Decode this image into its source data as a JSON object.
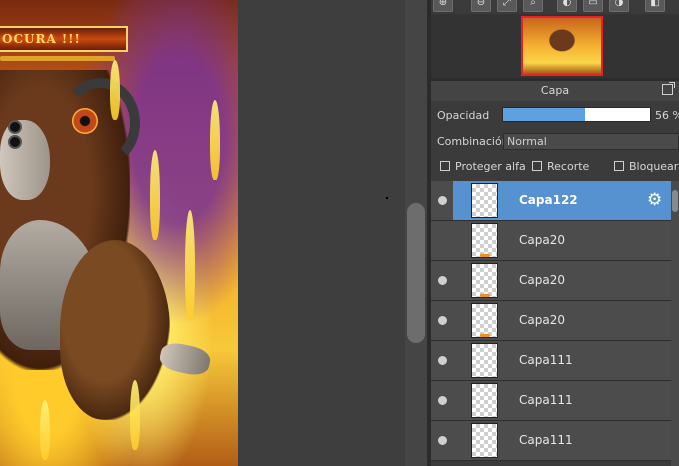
{
  "artwork": {
    "banner_text": "OCURA !!!"
  },
  "nav_toolbar": {
    "buttons": [
      "zoom-in",
      "zoom-out",
      "fit",
      "zoom-actual",
      "rotate-left",
      "print",
      "rotate-right",
      "flip"
    ]
  },
  "layer_panel": {
    "title": "Capa",
    "opacity_label": "Opacidad",
    "opacity_value": "56 %",
    "opacity_fraction": 0.56,
    "blend_label": "Combinación",
    "blend_value": "Normal",
    "checkboxes": {
      "protect_alpha": "Proteger alfa",
      "clipping": "Recorte",
      "lock": "Bloquear"
    },
    "layers": [
      {
        "name": "Capa122",
        "selected": true,
        "visible": true,
        "has_mark": false
      },
      {
        "name": "Capa20",
        "selected": false,
        "visible": false,
        "has_mark": true
      },
      {
        "name": "Capa20",
        "selected": false,
        "visible": true,
        "has_mark": true
      },
      {
        "name": "Capa20",
        "selected": false,
        "visible": true,
        "has_mark": true
      },
      {
        "name": "Capa111",
        "selected": false,
        "visible": true,
        "has_mark": false
      },
      {
        "name": "Capa111",
        "selected": false,
        "visible": true,
        "has_mark": false
      },
      {
        "name": "Capa111",
        "selected": false,
        "visible": true,
        "has_mark": false
      }
    ]
  },
  "colors": {
    "selection": "#5592cf",
    "opacity_fill": "#5da1e0",
    "nav_frame": "#e8202a"
  }
}
